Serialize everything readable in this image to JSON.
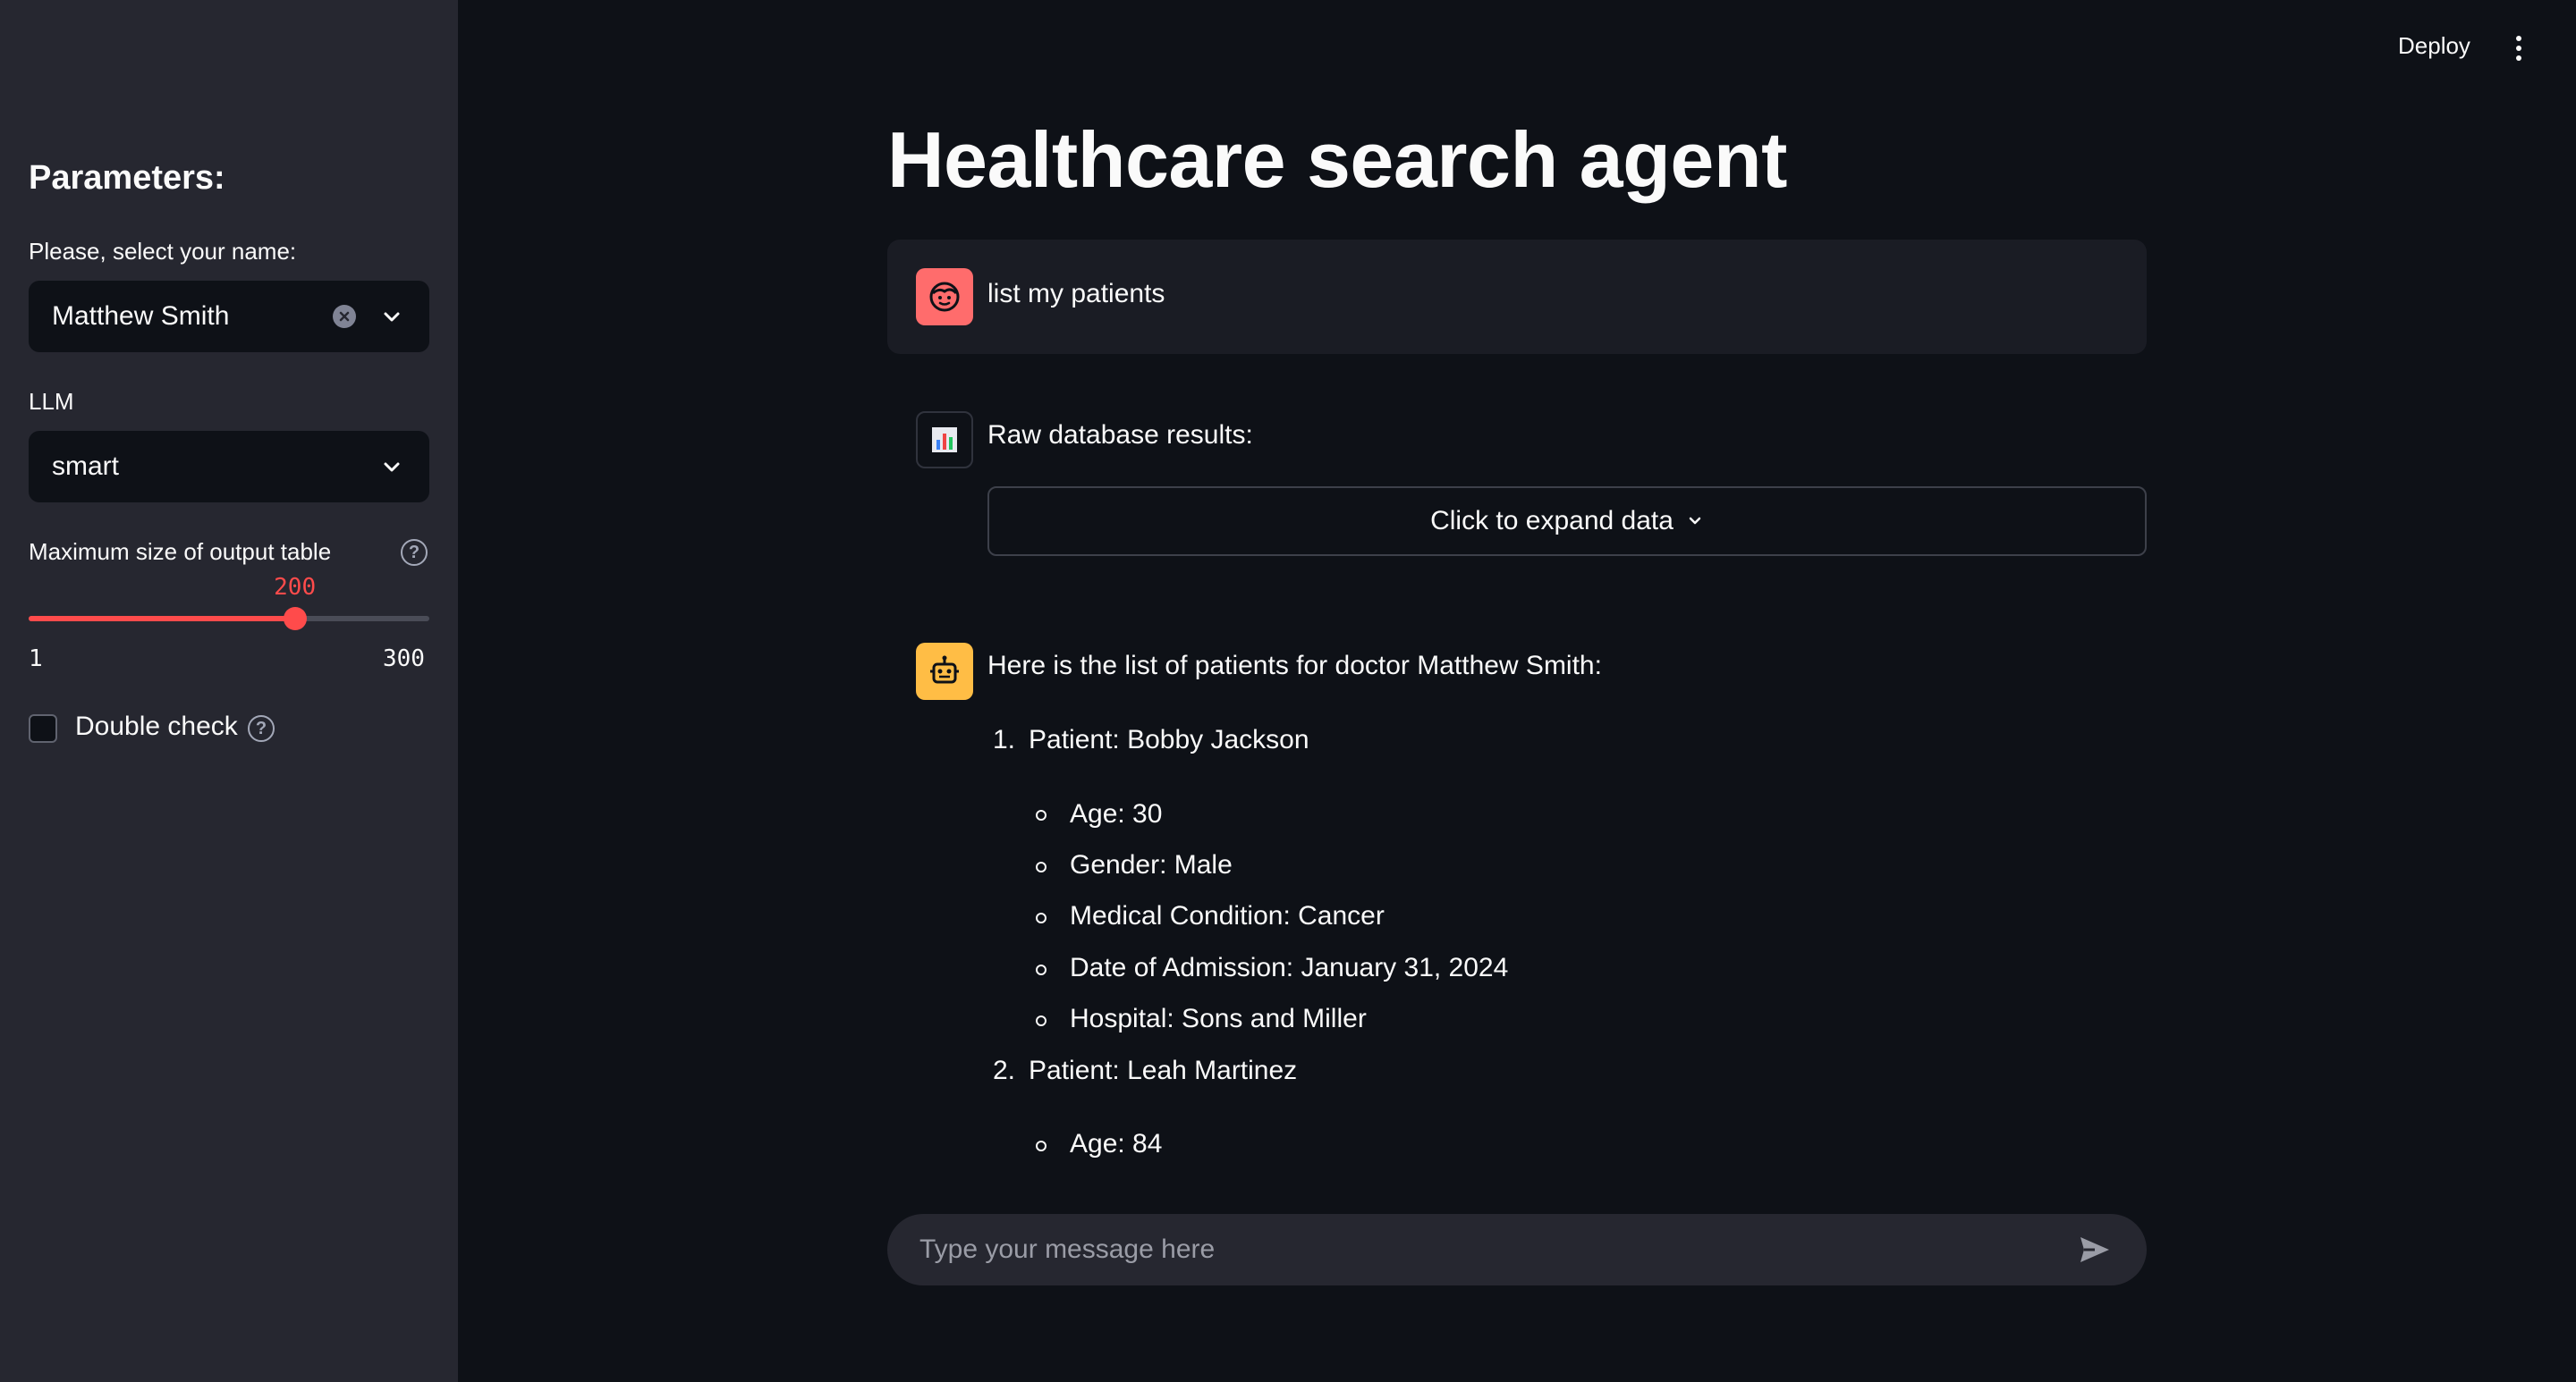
{
  "header": {
    "deploy_label": "Deploy"
  },
  "sidebar": {
    "title": "Parameters:",
    "name_select": {
      "label": "Please, select your name:",
      "value": "Matthew Smith"
    },
    "llm_select": {
      "label": "LLM",
      "value": "smart"
    },
    "slider": {
      "label": "Maximum size of output table",
      "value": 200,
      "min": 1,
      "max": 300,
      "value_text": "200",
      "min_text": "1",
      "max_text": "300"
    },
    "double_check": {
      "label": "Double check",
      "checked": false
    }
  },
  "main": {
    "title": "Healthcare search agent",
    "user_message": "list my patients",
    "tool_message": "Raw database results:",
    "expander_label": "Click to expand data",
    "assistant_intro": "Here is the list of patients for doctor Matthew Smith:",
    "patients": [
      {
        "num": "1.",
        "label": "Patient: Bobby Jackson",
        "details": [
          "Age: 30",
          "Gender: Male",
          "Medical Condition: Cancer",
          "Date of Admission: January 31, 2024",
          "Hospital: Sons and Miller"
        ]
      },
      {
        "num": "2.",
        "label": "Patient: Leah Martinez",
        "details": [
          "Age: 84"
        ]
      }
    ]
  },
  "chat_input": {
    "placeholder": "Type your message here"
  },
  "colors": {
    "accent": "#ff4b4b",
    "user_avatar": "#ff6c6c",
    "assistant_avatar": "#ffbd45"
  },
  "icons": [
    "clear-icon",
    "chevron-down-icon",
    "help-icon",
    "user-face-icon",
    "bar-chart-icon",
    "robot-icon",
    "send-icon",
    "more-vertical-icon"
  ]
}
